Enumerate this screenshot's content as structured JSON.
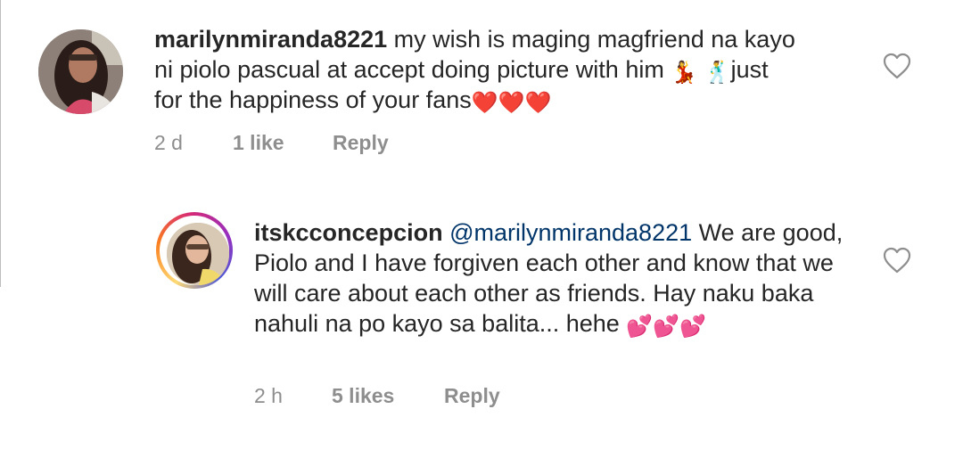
{
  "comments": [
    {
      "username": "marilynmiranda8221",
      "text_line1": " my wish is maging magfriend na kayo",
      "text_line2a": "ni piolo pascual at accept doing picture with him ",
      "emoji_a": "💃",
      "emoji_b": "🕺",
      "text_line2b": "just",
      "text_line3": "for the happiness of your fans",
      "emoji_hearts": "❤️❤️❤️",
      "time": "2 d",
      "likes": "1 like",
      "reply_label": "Reply"
    },
    {
      "username": "itskcconcepcion",
      "mention": "@marilynmiranda8221",
      "text": " We are good, Piolo and I have forgiven each other and know that we will care about each other as friends. Hay naku baka nahuli na po kayo sa balita... hehe ",
      "emoji_hearts": "💕💕💕",
      "time": "2 h",
      "likes": "5 likes",
      "reply_label": "Reply"
    }
  ],
  "icons": {
    "like": "heart-outline-icon"
  },
  "colors": {
    "mention": "#003569",
    "meta": "#8e8e8e",
    "text": "#262626"
  }
}
